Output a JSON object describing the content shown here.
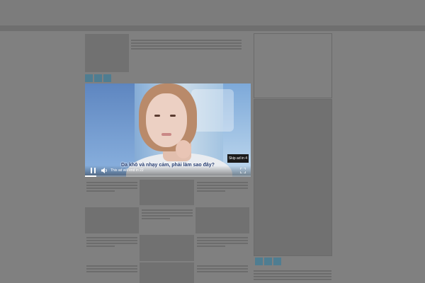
{
  "video_ad": {
    "skip_label": "Skip ad in 4",
    "subtitle": "Da khô và nhạy cảm, phải làm sao đây?",
    "ad_status": "This ad will end in 22",
    "progress": 0.07,
    "icons": {
      "play_pause": "pause-icon",
      "volume": "volume-icon",
      "fullscreen": "fullscreen-icon"
    }
  },
  "colors": {
    "overlay": "#808080",
    "accent_squares": "#4f7d91",
    "skip_button": "#1a1a1a"
  }
}
